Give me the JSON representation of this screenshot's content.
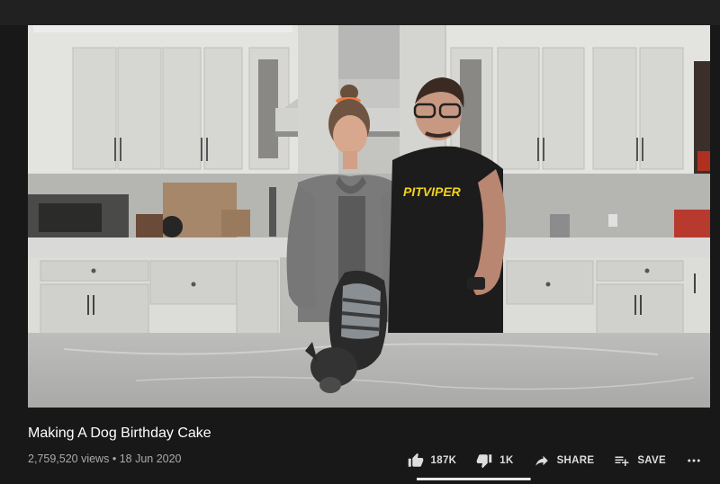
{
  "video": {
    "title": "Making A Dog Birthday Cake",
    "views": "2,759,520 views",
    "separator": "•",
    "date": "18 Jun 2020",
    "shirt_text": "PITVIPER"
  },
  "actions": {
    "like": {
      "icon": "thumbs-up-icon",
      "label": "187K"
    },
    "dislike": {
      "icon": "thumbs-down-icon",
      "label": "1K"
    },
    "share": {
      "icon": "share-arrow-icon",
      "label": "SHARE"
    },
    "save": {
      "icon": "playlist-add-icon",
      "label": "SAVE"
    },
    "more": {
      "icon": "more-horizontal-icon"
    }
  },
  "sentiment": {
    "like_fraction": 0.995
  },
  "colors": {
    "background": "#181818",
    "title_text": "#ffffff",
    "meta_text": "#aaaaaa",
    "action_text": "#dddddd",
    "shirt_logo": "#f2d31b"
  }
}
